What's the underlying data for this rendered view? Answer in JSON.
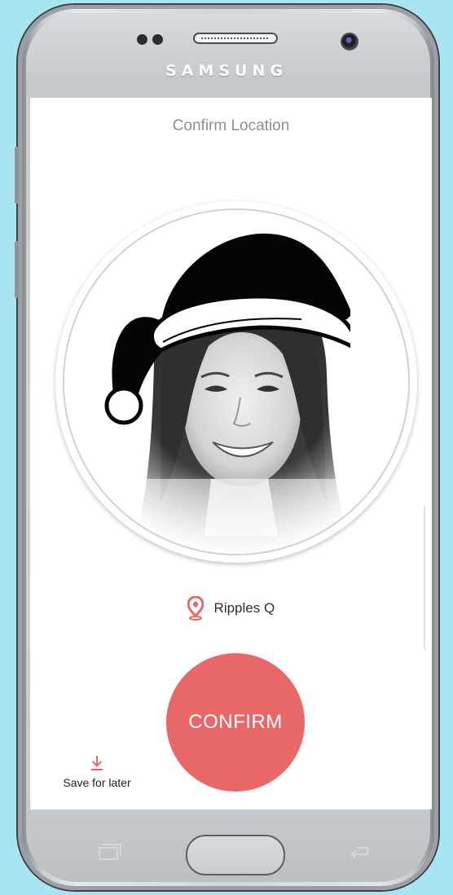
{
  "device": {
    "brand": "SAMSUNG"
  },
  "screen": {
    "title": "Confirm Location",
    "location_name": "Ripples Q",
    "confirm_label": "CONFIRM",
    "save_later_label": "Save for later"
  },
  "colors": {
    "accent": "#e86868",
    "background": "#a9e4f3",
    "title_text": "#8f8f8f"
  },
  "icons": {
    "location": "location-pin-icon",
    "save": "download-arrow-icon",
    "hat": "santa-hat-icon"
  }
}
